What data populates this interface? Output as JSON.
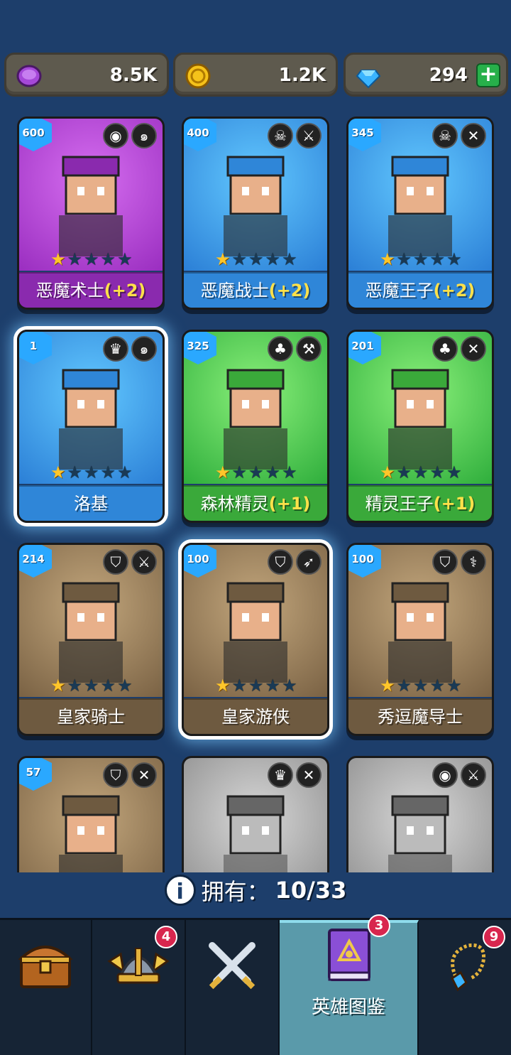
{
  "resources": {
    "purple_coin": {
      "icon": "purple-coin-icon",
      "value": "8.5K"
    },
    "gold_coin": {
      "icon": "gold-coin-icon",
      "value": "1.2K"
    },
    "gem": {
      "icon": "blue-gem-icon",
      "value": "294",
      "plus": "+"
    }
  },
  "heroes": [
    {
      "name": "恶魔术士",
      "bonus": "(+2)",
      "level": "600",
      "stars": 1,
      "max_stars": 5,
      "theme": "purple",
      "icons": [
        "cyclops-icon",
        "swirl-icon"
      ]
    },
    {
      "name": "恶魔战士",
      "bonus": "(+2)",
      "level": "400",
      "stars": 1,
      "max_stars": 5,
      "theme": "blue",
      "icons": [
        "skull-helm-icon",
        "sword-icon"
      ]
    },
    {
      "name": "恶魔王子",
      "bonus": "(+2)",
      "level": "345",
      "stars": 1,
      "max_stars": 5,
      "theme": "blue",
      "icons": [
        "skull-helm-icon",
        "dagger-icon"
      ]
    },
    {
      "name": "洛基",
      "bonus": "",
      "level": "1",
      "stars": 1,
      "max_stars": 5,
      "theme": "blue",
      "icons": [
        "winged-helm-icon",
        "swirl-icon"
      ],
      "selected": true
    },
    {
      "name": "森林精灵",
      "bonus": "(+1)",
      "level": "325",
      "stars": 1,
      "max_stars": 5,
      "theme": "green",
      "icons": [
        "elf-icon",
        "hammer-icon"
      ]
    },
    {
      "name": "精灵王子",
      "bonus": "(+1)",
      "level": "201",
      "stars": 1,
      "max_stars": 5,
      "theme": "green",
      "icons": [
        "elf-icon",
        "dagger-icon"
      ]
    },
    {
      "name": "皇家骑士",
      "bonus": "",
      "level": "214",
      "stars": 1,
      "max_stars": 5,
      "theme": "brown",
      "icons": [
        "knight-helm-icon",
        "sword-icon"
      ]
    },
    {
      "name": "皇家游侠",
      "bonus": "",
      "level": "100",
      "stars": 1,
      "max_stars": 5,
      "theme": "brown",
      "icons": [
        "knight-helm-icon",
        "bow-icon"
      ],
      "selected": true
    },
    {
      "name": "秀逗魔导士",
      "bonus": "",
      "level": "100",
      "stars": 1,
      "max_stars": 5,
      "theme": "brown",
      "icons": [
        "knight-helm-icon",
        "staff-icon"
      ]
    },
    {
      "name": "",
      "bonus": "",
      "level": "57",
      "stars": 0,
      "max_stars": 5,
      "theme": "brown",
      "icons": [
        "knight-helm-icon",
        "dagger-icon"
      ]
    },
    {
      "name": "",
      "bonus": "",
      "level": "",
      "stars": 0,
      "max_stars": 5,
      "theme": "locked",
      "icons": [
        "winged-helm-icon",
        "dagger-icon"
      ]
    },
    {
      "name": "",
      "bonus": "",
      "level": "",
      "stars": 0,
      "max_stars": 5,
      "theme": "locked",
      "icons": [
        "cyclops-icon",
        "sword-icon"
      ]
    }
  ],
  "owned": {
    "label": "拥有：",
    "count": "10/33"
  },
  "nav": [
    {
      "icon": "treasure-chest-icon",
      "label": "",
      "badge": ""
    },
    {
      "icon": "viking-helmet-icon",
      "label": "",
      "badge": "4"
    },
    {
      "icon": "crossed-swords-icon",
      "label": "",
      "badge": ""
    },
    {
      "icon": "hero-book-icon",
      "label": "英雄图鉴",
      "badge": "3",
      "active": true
    },
    {
      "icon": "amulet-icon",
      "label": "",
      "badge": "9"
    }
  ],
  "colors": {
    "background": "#1d3e6b",
    "purple": "#b23ed6",
    "blue": "#2b8fe0",
    "green": "#3fcf4a",
    "brown": "#8a7353",
    "locked": "#9a9a9a"
  }
}
